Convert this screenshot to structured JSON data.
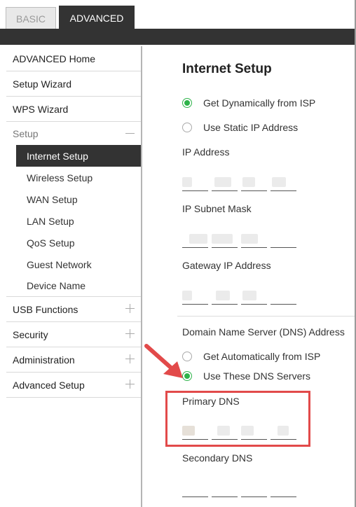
{
  "tabs": {
    "basic": "BASIC",
    "advanced": "ADVANCED"
  },
  "sidebar": {
    "advanced_home": "ADVANCED Home",
    "setup_wizard": "Setup Wizard",
    "wps_wizard": "WPS Wizard",
    "setup": "Setup",
    "setup_sub": [
      "Internet Setup",
      "Wireless Setup",
      "WAN Setup",
      "LAN Setup",
      "QoS Setup",
      "Guest Network",
      "Device Name"
    ],
    "usb_functions": "USB Functions",
    "security": "Security",
    "administration": "Administration",
    "advanced_setup": "Advanced Setup"
  },
  "main": {
    "title": "Internet Setup",
    "ip_options": {
      "dynamic": "Get Dynamically from ISP",
      "static": "Use Static IP Address",
      "selected": "dynamic"
    },
    "ip_address_label": "IP Address",
    "subnet_mask_label": "IP Subnet Mask",
    "gateway_label": "Gateway IP Address",
    "dns_section_label": "Domain Name Server (DNS) Address",
    "dns_options": {
      "auto": "Get Automatically from ISP",
      "manual": "Use These DNS Servers",
      "selected": "manual"
    },
    "primary_dns_label": "Primary DNS",
    "secondary_dns_label": "Secondary DNS"
  },
  "colors": {
    "accent_green": "#2eb34a",
    "highlight_red": "#e24a4a",
    "dark_bar": "#333333"
  }
}
